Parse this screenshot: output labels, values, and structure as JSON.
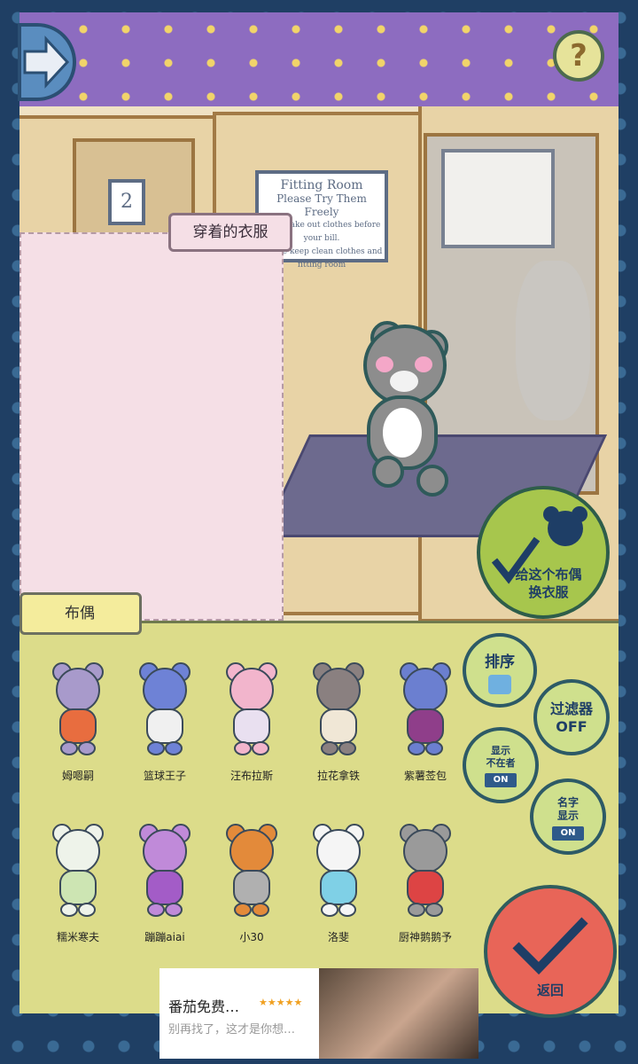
{
  "scene": {
    "sign_left": {
      "line1": "Fitting Room",
      "line2": "Please Try Them Freely",
      "line3": "Don't take out clothes before your bill.",
      "line4": "Please keep clean clothes and fitting room"
    },
    "booth_number": "2"
  },
  "panels": {
    "outfit_tab_label": "穿着的衣服",
    "doll_tab_label": "布偶"
  },
  "buttons": {
    "apply_label_1": "给这个布偶",
    "apply_label_2": "换衣服",
    "sort_label": "排序",
    "filter_label_1": "过滤器",
    "filter_label_2": "OFF",
    "hidden_label_1": "显示",
    "hidden_label_2": "不在者",
    "hidden_toggle": "ON",
    "name_label_1": "名字",
    "name_label_2": "显示",
    "name_toggle": "ON",
    "return_label": "返回",
    "help_glyph": "?"
  },
  "dolls": [
    {
      "name": "姆嗯嗣",
      "color": "#a89acb",
      "accent": "#e86d3f"
    },
    {
      "name": "篮球王子",
      "color": "#6e82d6",
      "accent": "#f0f0f0"
    },
    {
      "name": "汪布拉斯",
      "color": "#f2b5cc",
      "accent": "#e9e0f0"
    },
    {
      "name": "拉花拿铁",
      "color": "#8a8080",
      "accent": "#f0e7d6"
    },
    {
      "name": "紫薯莶包",
      "color": "#6b7fd0",
      "accent": "#8f3e8a"
    },
    {
      "name": "糯米寒夫",
      "color": "#eef3ea",
      "accent": "#cde5b3"
    },
    {
      "name": "蹦蹦aiai",
      "color": "#c08ad9",
      "accent": "#a35cc7"
    },
    {
      "name": "小30",
      "color": "#e38a3a",
      "accent": "#b0b0b0"
    },
    {
      "name": "洛斐",
      "color": "#f5f5f5",
      "accent": "#7fd0e6"
    },
    {
      "name": "厨神鹅鹅予",
      "color": "#9a9a9a",
      "accent": "#dd4444"
    }
  ],
  "ad": {
    "title": "番茄免费…",
    "subtitle": "别再找了，这才是你想…",
    "stars": "★★★★★"
  }
}
